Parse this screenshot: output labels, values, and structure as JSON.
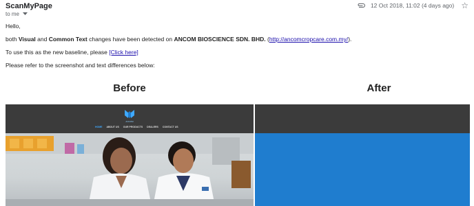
{
  "email": {
    "sender": "ScanMyPage",
    "recipient": "to me",
    "date": "12 Oct 2018, 11:02 (4 days ago)",
    "icons": {
      "attachment": "paperclip-icon",
      "star": "star-icon",
      "recipient_menu": "caret-down-icon"
    }
  },
  "message": {
    "greeting": "Hello,",
    "line1": {
      "prefix": "both ",
      "visual": "Visual",
      "and": " and ",
      "common_text": "Common Text",
      "middle": " changes have been detected on ",
      "company": "ANCOM BIOSCIENCE SDN. BHD.",
      "open_paren": " (",
      "url": "http://ancomcropcare.com.my/",
      "close": ")."
    },
    "line2": {
      "prefix": "To use this as the new baseline, please ",
      "link": "[Click here]"
    },
    "line3": "Please refer to the screenshot and text differences below:"
  },
  "comparison": {
    "before_label": "Before",
    "after_label": "After",
    "site": {
      "name": "ANCOM",
      "nav": [
        "HOME",
        "ABOUT US",
        "OUR PRODUCTS",
        "DEALERS",
        "CONTACT US"
      ]
    },
    "colors": {
      "header_dark": "#3b3b3b",
      "after_blue": "#1f7dcf",
      "logo_blue": "#3fa9ff"
    }
  }
}
